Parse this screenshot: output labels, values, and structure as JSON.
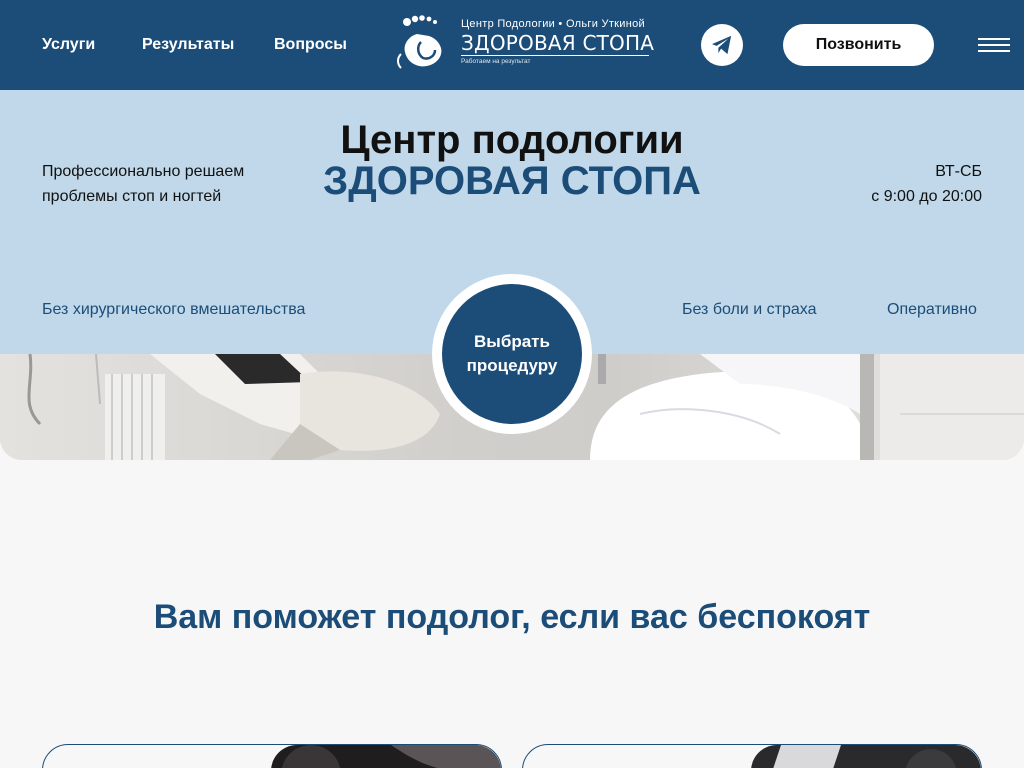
{
  "header": {
    "nav": [
      "Услуги",
      "Результаты",
      "Вопросы"
    ],
    "logo": {
      "top_line": "Центр Подологии • Ольги Уткиной",
      "brand": "ЗДОРОВАЯ СТОПА",
      "tagline": "Работаем на результат"
    },
    "telegram_icon": "telegram-icon",
    "call_label": "Позвонить",
    "menu_icon": "hamburger-icon"
  },
  "hero": {
    "title_line1": "Центр подологии",
    "title_line2": "ЗДОРОВАЯ СТОПА",
    "left_line1": "Профессионально решаем",
    "left_line2": "проблемы стоп и ногтей",
    "hours_days": "ВТ-СБ",
    "hours_time": "с 9:00 до 20:00",
    "features": [
      "Без хирургического вмешательства",
      "Без боли и страха",
      "Оперативно"
    ],
    "cta_line1": "Выбрать",
    "cta_line2": "процедуру"
  },
  "section": {
    "title": "Вам поможет подолог, если вас беспокоят"
  },
  "colors": {
    "primary": "#1c4d78",
    "hero_bg": "#c0d8e9",
    "page_bg": "#f7f7f8"
  }
}
